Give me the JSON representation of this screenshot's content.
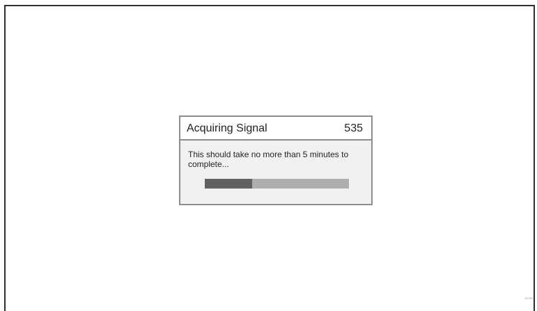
{
  "dialog": {
    "title": "Acquiring Signal",
    "count": "535",
    "message": "This should take no more than 5 minutes to complete...",
    "progress_fraction": 0.33
  },
  "footer": {
    "figure_code": "AC909"
  },
  "colors": {
    "dialog_border": "#8c8c8c",
    "dialog_body": "#f1f1f1",
    "progress_track": "#aeaeae",
    "progress_fill": "#616161"
  }
}
